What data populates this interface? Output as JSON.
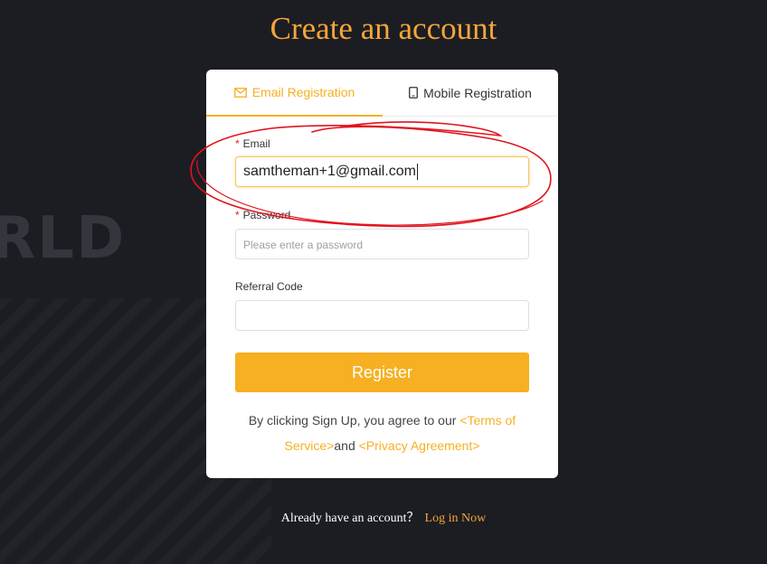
{
  "page": {
    "title": "Create an account",
    "background_word": "RLD"
  },
  "tabs": [
    {
      "label": "Email Registration",
      "icon": "mail-icon",
      "active": true
    },
    {
      "label": "Mobile Registration",
      "icon": "mobile-icon",
      "active": false
    }
  ],
  "form": {
    "email": {
      "label": "Email",
      "required_mark": "*",
      "value": "samtheman+1@gmail.com"
    },
    "password": {
      "label": "Password",
      "required_mark": "*",
      "placeholder": "Please enter a password",
      "value": ""
    },
    "referral": {
      "label": "Referral Code",
      "value": ""
    },
    "register_label": "Register"
  },
  "agreement": {
    "prefix": "By clicking Sign Up, you agree to our ",
    "terms_link": "<Terms of Service>",
    "conjunction": "and ",
    "privacy_link": "<Privacy Agreement>"
  },
  "footer": {
    "prompt": "Already have an account？",
    "login_link": "Log in Now"
  },
  "colors": {
    "accent": "#f6b021",
    "title": "#f4a53a",
    "background": "#1c1d22",
    "annotation": "#e0141e"
  }
}
